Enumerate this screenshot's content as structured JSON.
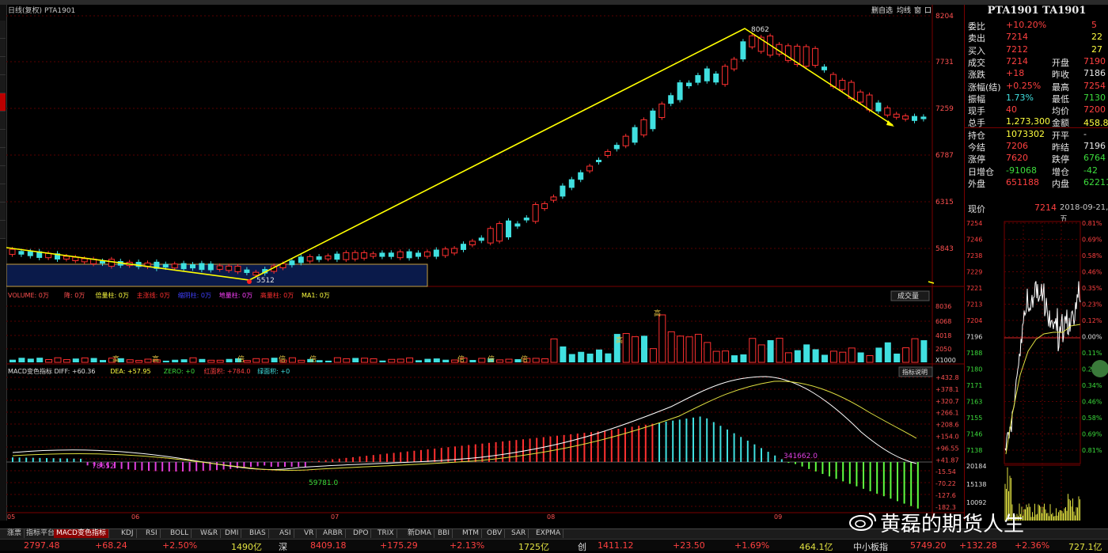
{
  "chart_header": {
    "period_label": "日线(复权)",
    "symbol": "PTA1901",
    "toolbar": [
      "删自选",
      "均线",
      "窗",
      "口"
    ]
  },
  "price_axis": [
    "8204",
    "7731",
    "7259",
    "6787",
    "6315",
    "5843"
  ],
  "annotations": {
    "high": "8062",
    "low": "5512"
  },
  "volume_header": {
    "items": [
      {
        "text": "VOLUME: 0万",
        "color": "#ff5050"
      },
      {
        "text": "降: 0万",
        "color": "#ff5050"
      },
      {
        "text": "倍量柱: 0万",
        "color": "#ffff40"
      },
      {
        "text": "主涨线: 0万",
        "color": "#ff3030"
      },
      {
        "text": "缩阴柱: 0万",
        "color": "#4040ff"
      },
      {
        "text": "地量柱: 0万",
        "color": "#ff40ff"
      },
      {
        "text": "高量柱: 0万",
        "color": "#ff3030"
      },
      {
        "text": "MA1: 0万",
        "color": "#ffff40"
      }
    ],
    "button": "成交量"
  },
  "volume_axis": [
    "8036",
    "6068",
    "4018",
    "2050",
    "X1000"
  ],
  "volume_labels": [
    "高",
    "高",
    "倍",
    "倍",
    "倍",
    "倍",
    "倍",
    "倍",
    "高",
    "高"
  ],
  "macd_header": {
    "items": [
      {
        "text": "MACD变色指标  DIFF: +60.36",
        "color": "#e0e0e0"
      },
      {
        "text": "DEA: +57.95",
        "color": "#ffff40"
      },
      {
        "text": "ZERO: +0",
        "color": "#3cdc3c"
      },
      {
        "text": "红面积: +784.0",
        "color": "#ff4040"
      },
      {
        "text": "绿面积: +0",
        "color": "#40e0e0"
      }
    ],
    "button": "指标说明"
  },
  "macd_axis": [
    "+432.8",
    "+378.1",
    "+320.7",
    "+266.1",
    "+208.6",
    "+154.0",
    "+96.55",
    "+41.87",
    "-15.54",
    "-70.22",
    "-127.6",
    "-182.3"
  ],
  "macd_labels": {
    "a": "78652",
    "b": "59781.0",
    "c": "341662.0"
  },
  "date_axis": [
    "05",
    "06",
    "07",
    "08",
    "09"
  ],
  "quote": {
    "title": "PTA1901 TA1901",
    "rows": [
      [
        {
          "t": "委比",
          "c": "white"
        },
        {
          "t": "+10.20%",
          "c": "red"
        },
        {
          "t": "5",
          "c": "red"
        }
      ],
      [
        {
          "t": "卖出",
          "c": "white"
        },
        {
          "t": "7214",
          "c": "red"
        },
        {
          "t": "22",
          "c": "yellow"
        }
      ],
      [
        {
          "t": "买入",
          "c": "white"
        },
        {
          "t": "7212",
          "c": "red"
        },
        {
          "t": "27",
          "c": "yellow"
        }
      ],
      [
        {
          "t": "成交",
          "c": "white"
        },
        {
          "t": "7214",
          "c": "red"
        },
        {
          "t": "开盘",
          "c": "white"
        },
        {
          "t": "7190",
          "c": "red"
        }
      ],
      [
        {
          "t": "涨跌",
          "c": "white"
        },
        {
          "t": "+18",
          "c": "red"
        },
        {
          "t": "昨收",
          "c": "white"
        },
        {
          "t": "7186",
          "c": "white"
        }
      ],
      [
        {
          "t": "涨幅(结)",
          "c": "white"
        },
        {
          "t": "+0.25%",
          "c": "red"
        },
        {
          "t": "最高",
          "c": "white"
        },
        {
          "t": "7254",
          "c": "red"
        }
      ],
      [
        {
          "t": "振幅",
          "c": "white"
        },
        {
          "t": "1.73%",
          "c": "cyan"
        },
        {
          "t": "最低",
          "c": "white"
        },
        {
          "t": "7130",
          "c": "green"
        }
      ],
      [
        {
          "t": "现手",
          "c": "white"
        },
        {
          "t": "40",
          "c": "red"
        },
        {
          "t": "均价",
          "c": "white"
        },
        {
          "t": "7200",
          "c": "red"
        }
      ],
      [
        {
          "t": "总手",
          "c": "white"
        },
        {
          "t": "1,273,300",
          "c": "yellow"
        },
        {
          "t": "金额",
          "c": "white"
        },
        {
          "t": "458.8亿",
          "c": "yellow"
        }
      ],
      [
        {
          "t": "持仓",
          "c": "white"
        },
        {
          "t": "1073302",
          "c": "yellow"
        },
        {
          "t": "开平",
          "c": "white"
        },
        {
          "t": "-",
          "c": "white"
        }
      ],
      [
        {
          "t": "今结",
          "c": "white"
        },
        {
          "t": "7206",
          "c": "red"
        },
        {
          "t": "昨结",
          "c": "white"
        },
        {
          "t": "7196",
          "c": "white"
        }
      ],
      [
        {
          "t": "涨停",
          "c": "white"
        },
        {
          "t": "7620",
          "c": "red"
        },
        {
          "t": "跌停",
          "c": "white"
        },
        {
          "t": "6764",
          "c": "green"
        }
      ],
      [
        {
          "t": "日增仓",
          "c": "white"
        },
        {
          "t": "-91068",
          "c": "green"
        },
        {
          "t": "增仓",
          "c": "white"
        },
        {
          "t": "-42",
          "c": "green"
        }
      ],
      [
        {
          "t": "外盘",
          "c": "white"
        },
        {
          "t": "651188",
          "c": "red"
        },
        {
          "t": "内盘",
          "c": "white"
        },
        {
          "t": "622112",
          "c": "green"
        }
      ]
    ],
    "now_label": "现价",
    "now_price": "7214",
    "date": "2018-09-21,五"
  },
  "intraday": {
    "price_ticks": [
      "7254",
      "7246",
      "7238",
      "7229",
      "7221",
      "7213",
      "7204",
      "7196",
      "7188",
      "7180",
      "7171",
      "7163",
      "7155",
      "7146",
      "7138"
    ],
    "pct_ticks": [
      "0.81%",
      "0.69%",
      "0.58%",
      "0.46%",
      "0.35%",
      "0.23%",
      "0.12%",
      "0.00%",
      "0.11%",
      "0.23%",
      "0.34%",
      "0.46%",
      "0.58%",
      "0.69%",
      "0.81%"
    ],
    "vol_ticks": [
      "20184",
      "15138",
      "10092",
      "5046"
    ]
  },
  "tabs": [
    "涨票",
    "指标平台",
    "MACD变色指标",
    "KDJ",
    "RSI",
    "BOLL",
    "W&R",
    "DMI",
    "BIAS",
    "ASI",
    "VR",
    "ARBR",
    "DPO",
    "TRIX",
    "新DMA",
    "BBI",
    "MTM",
    "OBV",
    "SAR",
    "EXPMA"
  ],
  "active_tab": "MACD变色指标",
  "statusbar": [
    {
      "t": "2797.48",
      "c": "#ff4040"
    },
    {
      "t": "+68.24",
      "c": "#ff4040"
    },
    {
      "t": "+2.50%",
      "c": "#ff4040"
    },
    {
      "t": "1490亿",
      "c": "#e0e040"
    },
    {
      "t": "深",
      "c": "#e0e0e0"
    },
    {
      "t": "8409.18",
      "c": "#ff4040"
    },
    {
      "t": "+175.29",
      "c": "#ff4040"
    },
    {
      "t": "+2.13%",
      "c": "#ff4040"
    },
    {
      "t": "1725亿",
      "c": "#e0e040"
    },
    {
      "t": "创",
      "c": "#e0e0e0"
    },
    {
      "t": "1411.12",
      "c": "#ff4040"
    },
    {
      "t": "+23.50",
      "c": "#ff4040"
    },
    {
      "t": "+1.69%",
      "c": "#ff4040"
    },
    {
      "t": "464.1亿",
      "c": "#e0e040"
    },
    {
      "t": "中小板指",
      "c": "#e0e0e0"
    },
    {
      "t": "5749.20",
      "c": "#ff4040"
    },
    {
      "t": "+132.28",
      "c": "#ff4040"
    },
    {
      "t": "+2.36%",
      "c": "#ff4040"
    },
    {
      "t": "727.1亿",
      "c": "#e0e040"
    }
  ],
  "watermark": "黄磊的期货人生"
}
